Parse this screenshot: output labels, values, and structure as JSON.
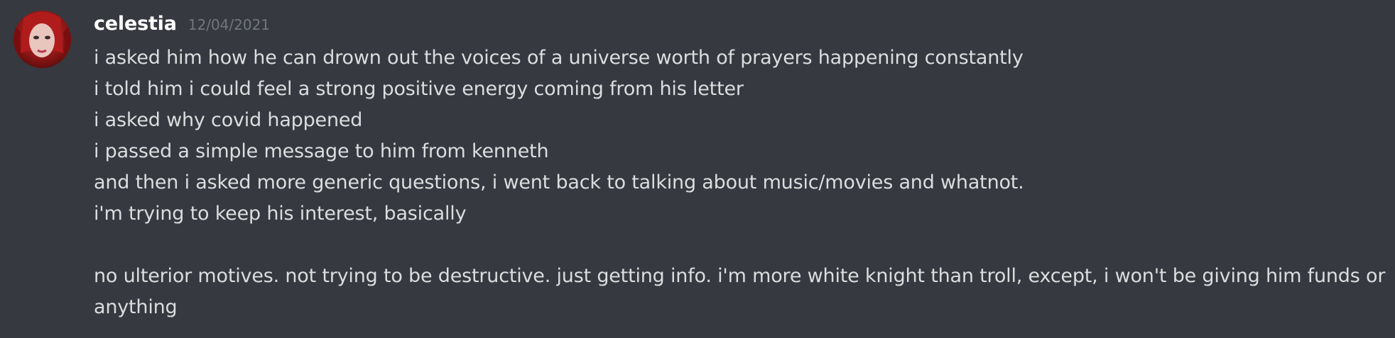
{
  "message": {
    "author": {
      "username": "celestia",
      "avatar_icon": "avatar-image"
    },
    "timestamp": "12/04/2021",
    "lines": [
      "i asked him how he can drown out the voices of a universe worth of prayers happening constantly",
      "i told him i could feel a strong positive energy coming from his letter",
      "i asked why covid happened",
      "i passed a simple message to him from kenneth",
      "and then i asked more generic questions, i went back to talking about music/movies and whatnot.",
      "i'm trying to keep his interest, basically",
      "",
      "no ulterior motives. not trying to be destructive. just getting info. i'm more white knight than troll, except, i won't be giving him funds or anything"
    ]
  },
  "colors": {
    "background": "#36393f",
    "username": "#ffffff",
    "timestamp": "#72767d",
    "text": "#dcddde"
  }
}
